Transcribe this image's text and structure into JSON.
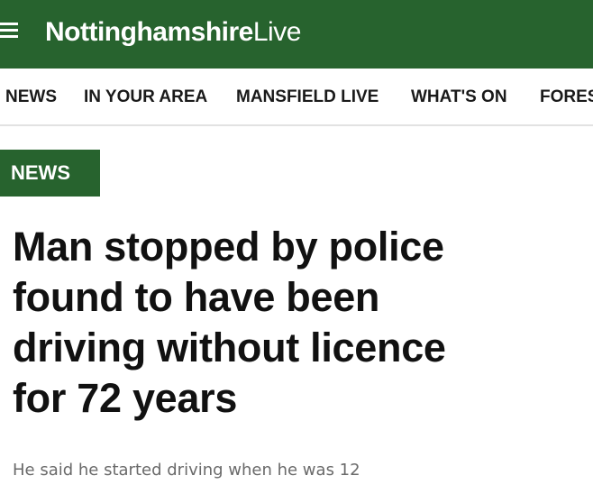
{
  "header": {
    "logo_strong": "Nottinghamshire",
    "logo_light": "Live",
    "menu_icon": "hamburger-menu-icon",
    "brand_color": "#27632e"
  },
  "nav": {
    "items": [
      {
        "label": "NEWS"
      },
      {
        "label": "IN YOUR AREA"
      },
      {
        "label": "MANSFIELD LIVE"
      },
      {
        "label": "WHAT'S ON"
      },
      {
        "label": "FORES"
      }
    ]
  },
  "article": {
    "category": "NEWS",
    "headline_lines": [
      "Man stopped by police",
      "found to have been",
      "driving without licence",
      "for 72 years"
    ],
    "standfirst": "He said he started driving when he was 12"
  }
}
